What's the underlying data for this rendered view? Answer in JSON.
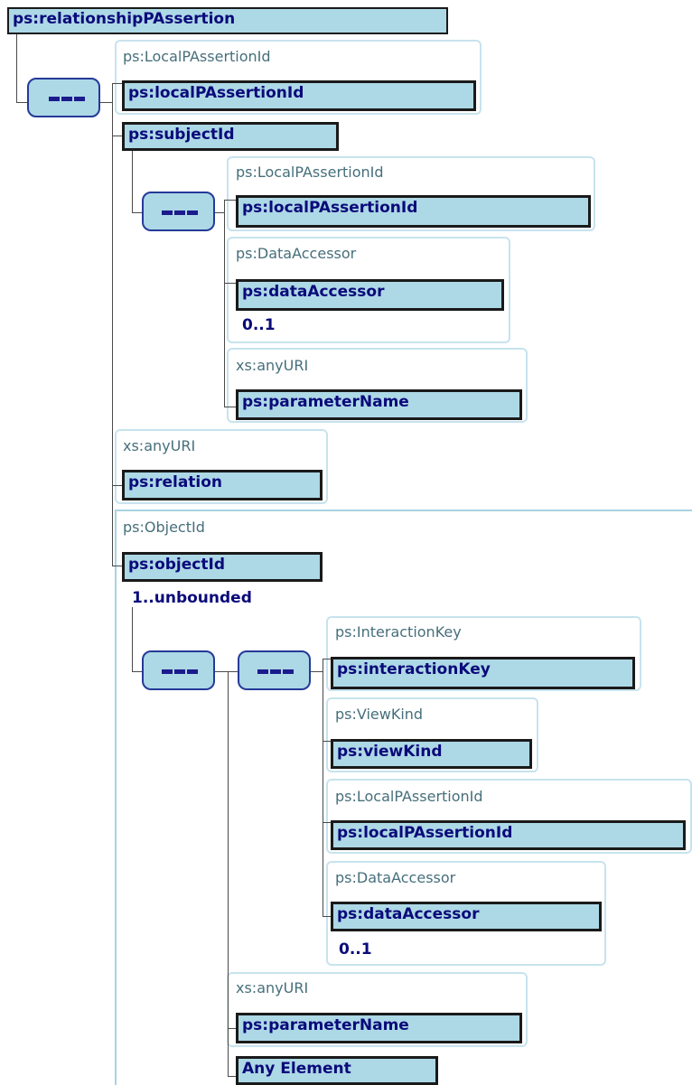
{
  "root": {
    "label": "ps:relationshipPAssertion"
  },
  "subject_group": {
    "local_id": {
      "type": "ps:LocalPAssertionId",
      "name": "ps:localPAssertionId"
    },
    "subject_id": {
      "name": "ps:subjectId"
    },
    "subject_local_id": {
      "type": "ps:LocalPAssertionId",
      "name": "ps:localPAssertionId"
    },
    "subject_data_accessor": {
      "type": "ps:DataAccessor",
      "name": "ps:dataAccessor",
      "cardinality": "0..1"
    },
    "subject_parameter_name": {
      "type": "xs:anyURI",
      "name": "ps:parameterName"
    }
  },
  "relation": {
    "type": "xs:anyURI",
    "name": "ps:relation"
  },
  "object_group": {
    "object_id": {
      "type": "ps:ObjectId",
      "name": "ps:objectId",
      "cardinality": "1..unbounded"
    },
    "interaction_key": {
      "type": "ps:InteractionKey",
      "name": "ps:interactionKey"
    },
    "view_kind": {
      "type": "ps:ViewKind",
      "name": "ps:viewKind"
    },
    "object_local_id": {
      "type": "ps:LocalPAssertionId",
      "name": "ps:localPAssertionId"
    },
    "object_data_accessor": {
      "type": "ps:DataAccessor",
      "name": "ps:dataAccessor",
      "cardinality": "0..1"
    },
    "object_parameter_name": {
      "type": "xs:anyURI",
      "name": "ps:parameterName"
    },
    "any_element": {
      "name": "Any Element"
    }
  },
  "colors": {
    "element_fill": "#add8e6",
    "frame_border": "#c7e3ee",
    "element_text": "#0a0a7a",
    "type_text": "#466f7b"
  }
}
